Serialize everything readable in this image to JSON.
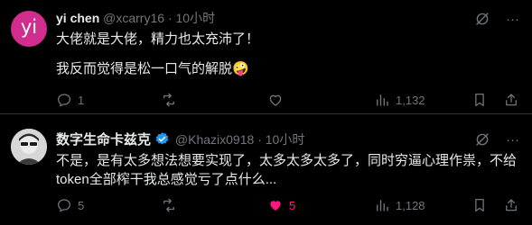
{
  "posts": [
    {
      "avatar_letter": "yi",
      "name": "yi chen",
      "handle": "@xcarry16",
      "separator": "·",
      "time": "10小时",
      "lines": [
        "大佬就是大佬，精力也太充沛了！",
        "我反而觉得是松一口气的解脱🤪"
      ],
      "more": "···",
      "stats": {
        "replies": "1",
        "reposts": "",
        "likes": "",
        "views": "1,132"
      },
      "liked": false
    },
    {
      "name": "数字生命卡兹克",
      "verified": true,
      "handle": "@Khazix0918",
      "separator": "·",
      "time": "10小时",
      "lines": [
        "不是，是有太多想法想要实现了，太多太多太多了，同时穷逼心理作祟，不给",
        "token全部榨干我总感觉亏了点什么..."
      ],
      "more": "···",
      "stats": {
        "replies": "5",
        "reposts": "",
        "likes": "5",
        "views": "1,128"
      },
      "liked": true
    }
  ],
  "colors": {
    "accent_like": "#f91880",
    "verified": "#1d9bf0",
    "muted": "#71767b",
    "text": "#e7e9ea",
    "background": "#000000"
  }
}
